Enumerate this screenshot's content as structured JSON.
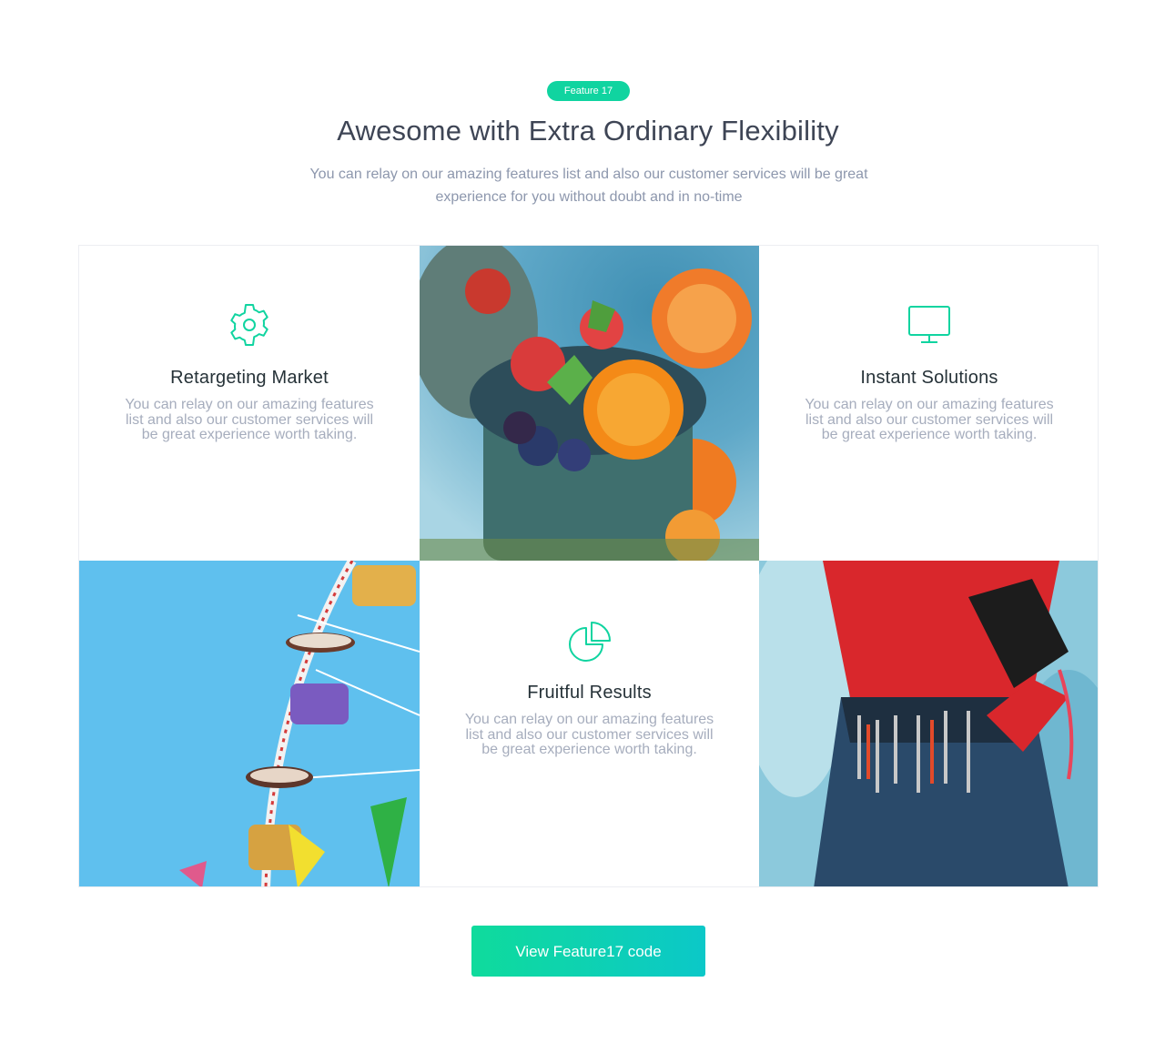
{
  "header": {
    "badge": "Feature 17",
    "title": "Awesome with Extra Ordinary Flexibility",
    "subtitle": "You can relay on our amazing features list and also our customer services will be great experience for you without doubt and in no-time"
  },
  "features": [
    {
      "icon": "gear-icon",
      "title": "Retargeting Market",
      "text": "You can relay on our amazing features list and also our customer services will be great experience worth taking."
    },
    {
      "icon": "monitor-icon",
      "title": "Instant Solutions",
      "text": "You can relay on our amazing features list and also our customer services will be great experience worth taking."
    },
    {
      "icon": "pie-chart-icon",
      "title": "Fruitful Results",
      "text": "You can relay on our amazing features list and also our customer services will be great experience worth taking."
    }
  ],
  "images": [
    "fruit-smoothie-photo",
    "ferris-wheel-photo",
    "climber-photo"
  ],
  "cta": {
    "label": "View Feature17 code"
  },
  "colors": {
    "accent": "#10d4a0",
    "heading": "#3e4555",
    "muted": "#8d97ad"
  }
}
